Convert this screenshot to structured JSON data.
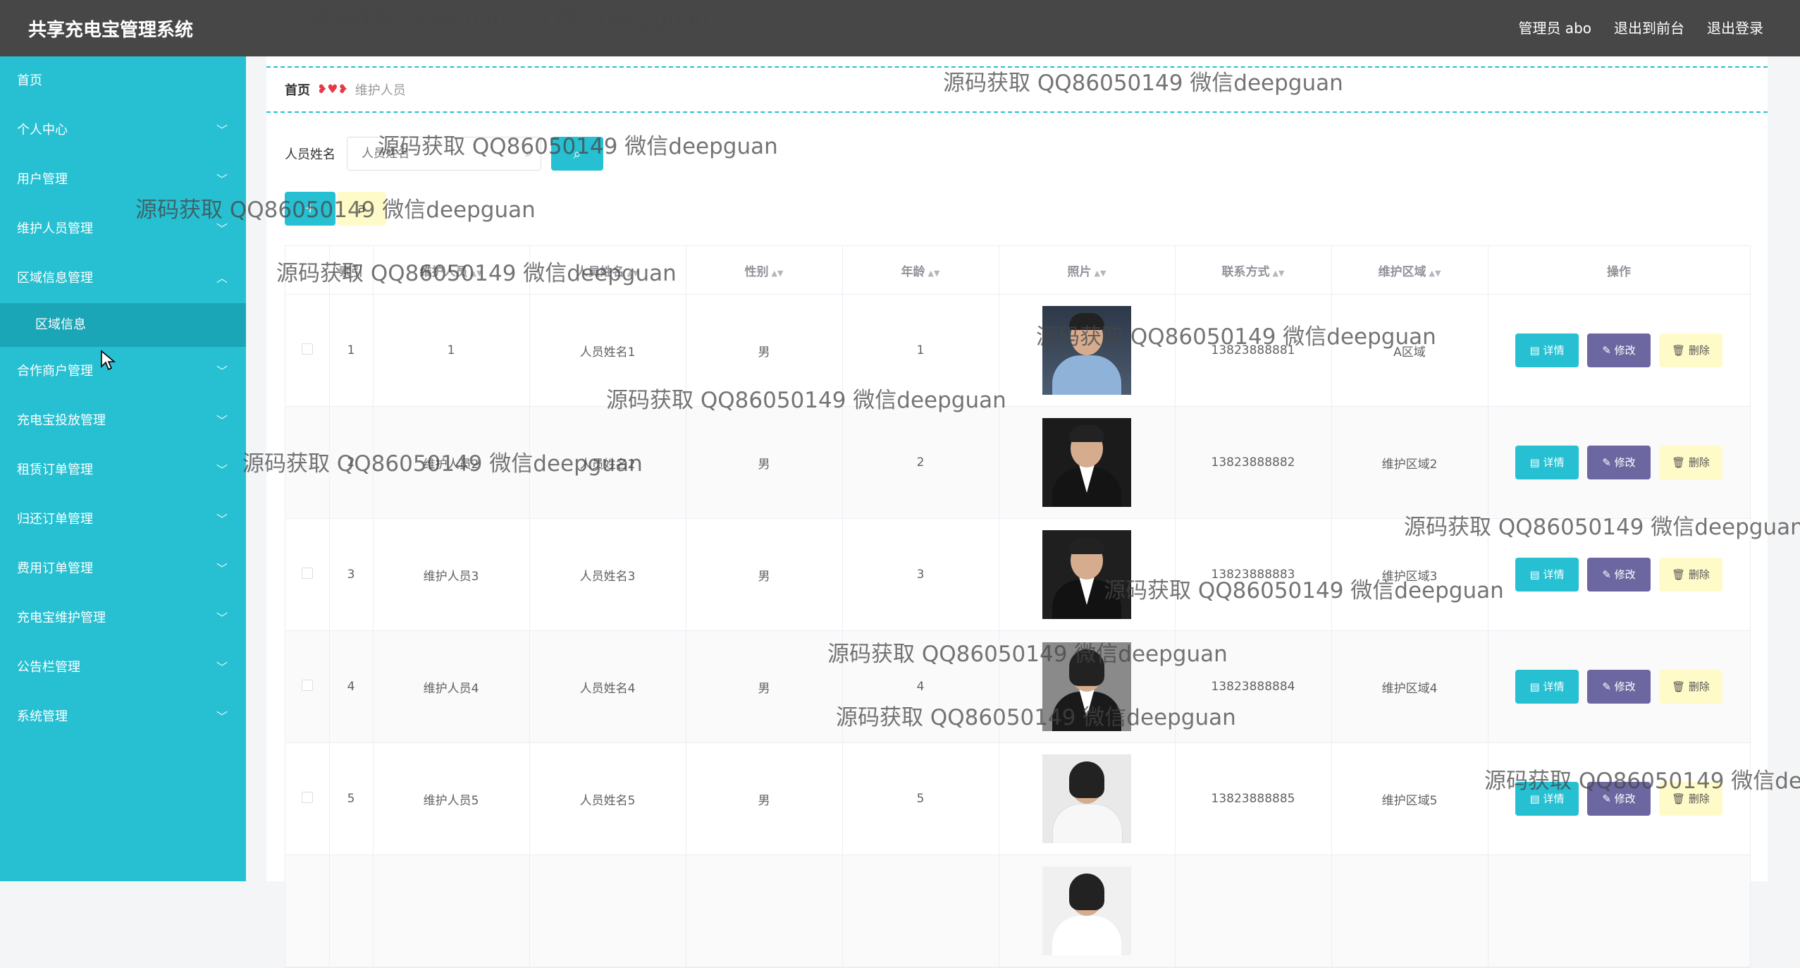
{
  "app": {
    "title": "共享充电宝管理系统",
    "user_label": "管理员 abo",
    "to_front_label": "退出到前台",
    "logout_label": "退出登录"
  },
  "sidebar": {
    "items": [
      {
        "label": "首页",
        "expandable": false
      },
      {
        "label": "个人中心",
        "expandable": true,
        "icon": "chevron-down-icon"
      },
      {
        "label": "用户管理",
        "expandable": true,
        "icon": "chevron-down-icon"
      },
      {
        "label": "维护人员管理",
        "expandable": true,
        "icon": "chevron-down-icon"
      },
      {
        "label": "区域信息管理",
        "expandable": true,
        "expanded": true,
        "icon": "chevron-up-icon"
      },
      {
        "label": "合作商户管理",
        "expandable": true,
        "icon": "chevron-down-icon"
      },
      {
        "label": "充电宝投放管理",
        "expandable": true,
        "icon": "chevron-down-icon"
      },
      {
        "label": "租赁订单管理",
        "expandable": true,
        "icon": "chevron-down-icon"
      },
      {
        "label": "归还订单管理",
        "expandable": true,
        "icon": "chevron-down-icon"
      },
      {
        "label": "费用订单管理",
        "expandable": true,
        "icon": "chevron-down-icon"
      },
      {
        "label": "充电宝维护管理",
        "expandable": true,
        "icon": "chevron-down-icon"
      },
      {
        "label": "公告栏管理",
        "expandable": true,
        "icon": "chevron-down-icon"
      },
      {
        "label": "系统管理",
        "expandable": true,
        "icon": "chevron-down-icon"
      }
    ],
    "subitem": "区域信息"
  },
  "breadcrumb": {
    "home": "首页",
    "separator": "❥♥❥",
    "current": "维护人员"
  },
  "search": {
    "label": "人员姓名",
    "placeholder": "人员姓名",
    "value": "",
    "button_icon": "search-icon"
  },
  "actions": {
    "add_label": "+",
    "delete_label": "a"
  },
  "table": {
    "columns": [
      "",
      "索引",
      "维护人员",
      "人员姓名",
      "性别",
      "年龄",
      "照片",
      "联系方式",
      "维护区域",
      "操作"
    ],
    "rows": [
      {
        "index": "1",
        "staff": "1",
        "name": "人员姓名1",
        "gender": "男",
        "age": "1",
        "phone": "13823888881",
        "area": "A区域"
      },
      {
        "index": "2",
        "staff": "维护人员2",
        "name": "人员姓名2",
        "gender": "男",
        "age": "2",
        "phone": "13823888882",
        "area": "维护区域2"
      },
      {
        "index": "3",
        "staff": "维护人员3",
        "name": "人员姓名3",
        "gender": "男",
        "age": "3",
        "phone": "13823888883",
        "area": "维护区域3"
      },
      {
        "index": "4",
        "staff": "维护人员4",
        "name": "人员姓名4",
        "gender": "男",
        "age": "4",
        "phone": "13823888884",
        "area": "维护区域4"
      },
      {
        "index": "5",
        "staff": "维护人员5",
        "name": "人员姓名5",
        "gender": "男",
        "age": "5",
        "phone": "13823888885",
        "area": "维护区域5"
      }
    ],
    "op_detail": "详情",
    "op_edit": "修改",
    "op_delete": "删除"
  },
  "watermark": "源码获取 QQ86050149 微信deepguan",
  "colors": {
    "accent": "#26c0d2",
    "topbar": "#474747",
    "edit": "#6c67a0",
    "warning": "#fffbc9"
  }
}
